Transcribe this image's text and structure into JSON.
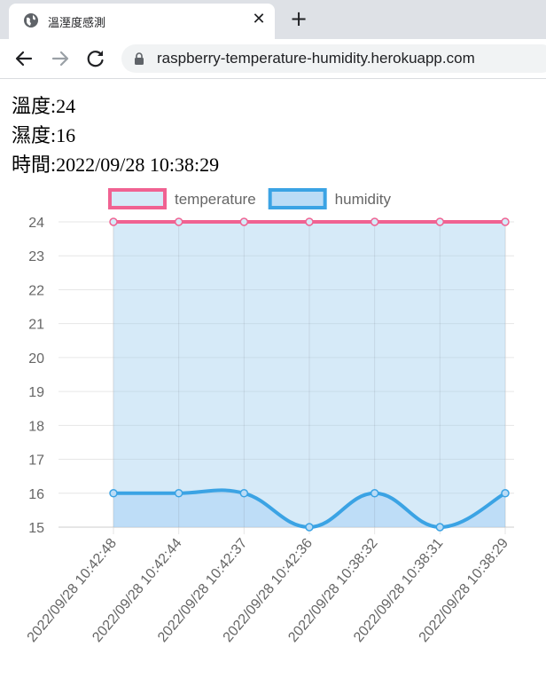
{
  "browser": {
    "tab_title": "溫溼度感測",
    "url": "raspberry-temperature-humidity.herokuapp.com"
  },
  "readings": {
    "temperature_label": "溫度",
    "temperature_value": "24",
    "humidity_label": "濕度",
    "humidity_value": "16",
    "time_label": "時間",
    "time_value": "2022/09/28 10:38:29"
  },
  "chart_data": {
    "type": "line",
    "categories": [
      "2022/09/28 10:42:48",
      "2022/09/28 10:42:44",
      "2022/09/28 10:42:37",
      "2022/09/28 10:42:36",
      "2022/09/28 10:38:32",
      "2022/09/28 10:38:31",
      "2022/09/28 10:38:29"
    ],
    "series": [
      {
        "name": "temperature",
        "values": [
          24,
          24,
          24,
          24,
          24,
          24,
          24
        ],
        "color": "#f06292",
        "fill": "#d6eaf8"
      },
      {
        "name": "humidity",
        "values": [
          16,
          16,
          16,
          15,
          16,
          15,
          16
        ],
        "color": "#3ba3e4",
        "fill": "#bbdcf6"
      }
    ],
    "ylim": [
      15,
      24
    ],
    "yticks": [
      15,
      16,
      17,
      18,
      19,
      20,
      21,
      22,
      23,
      24
    ],
    "legend": "top",
    "grid": true
  }
}
